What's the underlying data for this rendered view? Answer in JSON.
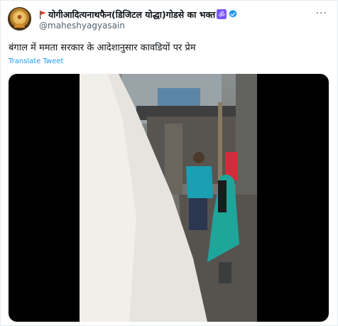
{
  "tweet": {
    "display_name": "योगीआदित्यनाथफैन(डिजिटल योद्धा)गोडसे का भक्त",
    "handle": "@maheshyagyasain",
    "text": "बंगाल में ममता सरकार के आदेशानुसार कावडियों पर प्रेम",
    "translate_label": "Translate Tweet"
  },
  "icons": {
    "flag": "flag-icon",
    "om": "om-icon",
    "verified": "verified-badge-icon",
    "more": "more-options-icon"
  },
  "colors": {
    "accent": "#1d9bf0",
    "om_purple": "#7856ff",
    "flag_red": "#e0392b",
    "text_primary": "#0f1419",
    "text_secondary": "#536471"
  }
}
